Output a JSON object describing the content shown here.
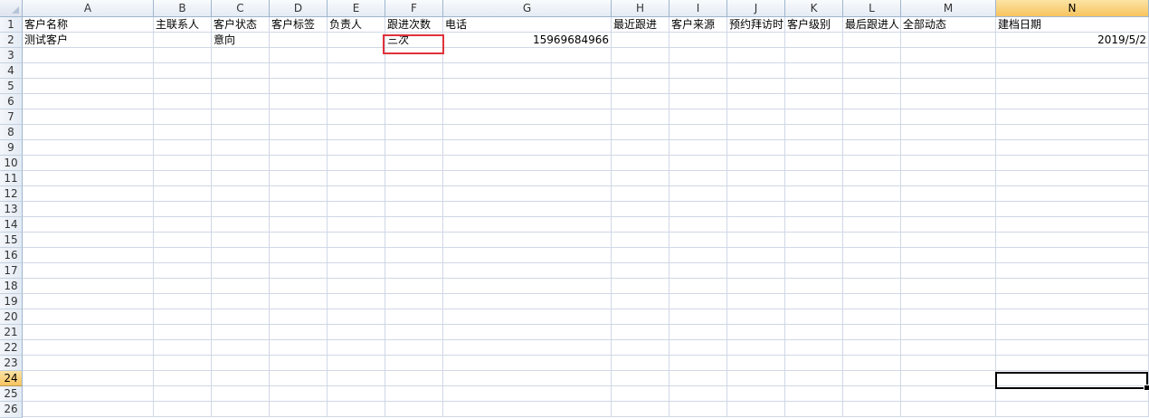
{
  "columns": [
    "A",
    "B",
    "C",
    "D",
    "E",
    "F",
    "G",
    "H",
    "I",
    "J",
    "K",
    "L",
    "M",
    "N"
  ],
  "selected_column": "N",
  "rows": [
    "1",
    "2",
    "3",
    "4",
    "5",
    "6",
    "7",
    "8",
    "9",
    "10",
    "11",
    "12",
    "13",
    "14",
    "15",
    "16",
    "17",
    "18",
    "19",
    "20",
    "21",
    "22",
    "23",
    "24",
    "25",
    "26"
  ],
  "selected_row": "24",
  "headers": {
    "A": "客户名称",
    "B": "主联系人",
    "C": "客户状态",
    "D": "客户标签",
    "E": "负责人",
    "F": "跟进次数",
    "G": "电话",
    "H": "最近跟进",
    "I": "客户来源",
    "J": "预约拜访时",
    "K": "客户级别",
    "L": "最后跟进人",
    "M": "全部动态",
    "N": "建档日期"
  },
  "row2": {
    "A": "测试客户",
    "C": "意向",
    "F": "三次",
    "G": "15969684966",
    "N": "2019/5/2"
  },
  "highlighted_cell": "F2",
  "active_cell": "N24",
  "colors": {
    "highlight_border": "#e0323a",
    "grid_line": "#d0d7e5",
    "header_border": "#9eb6ce",
    "selected_header": "#f7c45f"
  }
}
